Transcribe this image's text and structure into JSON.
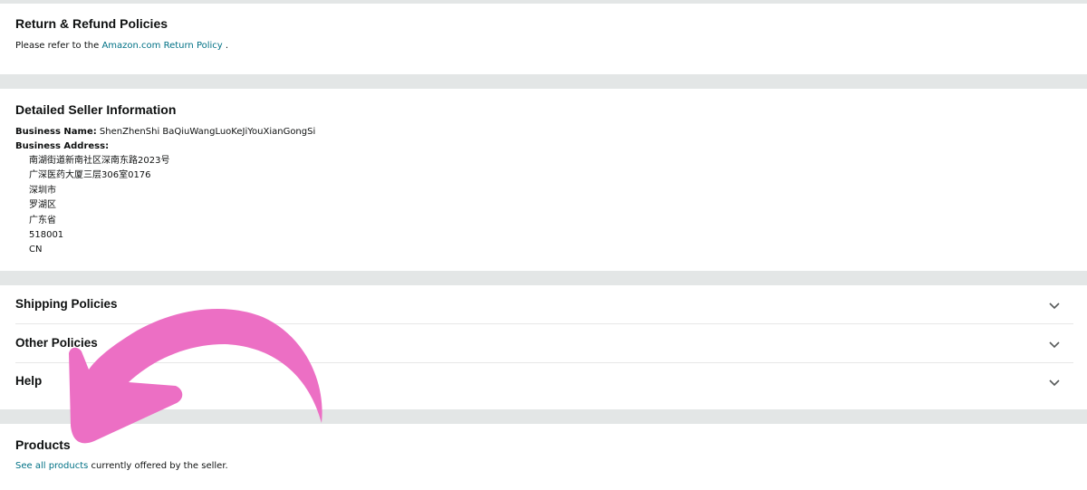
{
  "return_policy": {
    "heading": "Return & Refund Policies",
    "text_before": "Please refer to the ",
    "link": "Amazon.com Return Policy",
    "text_after": " ."
  },
  "seller_info": {
    "heading": "Detailed Seller Information",
    "business_name_label": "Business Name:",
    "business_name": " ShenZhenShi BaQiuWangLuoKeJiYouXianGongSi",
    "business_address_label": "Business Address:",
    "address_lines": [
      "南湖街道新南社区深南东路2023号",
      "广深医药大厦三层306室0176",
      "深圳市",
      "罗湖区",
      "广东省",
      "518001",
      "CN"
    ]
  },
  "accordion": [
    {
      "label": "Shipping Policies",
      "icon": "chevron-down-icon"
    },
    {
      "label": "Other Policies",
      "icon": "chevron-down-icon"
    },
    {
      "label": "Help",
      "icon": "chevron-down-icon"
    }
  ],
  "products": {
    "heading": "Products",
    "link": "See all products",
    "text_after": " currently offered by the seller."
  },
  "colors": {
    "link": "#007185",
    "band": "#e3e6e6",
    "arrow": "#ec6fc4"
  }
}
